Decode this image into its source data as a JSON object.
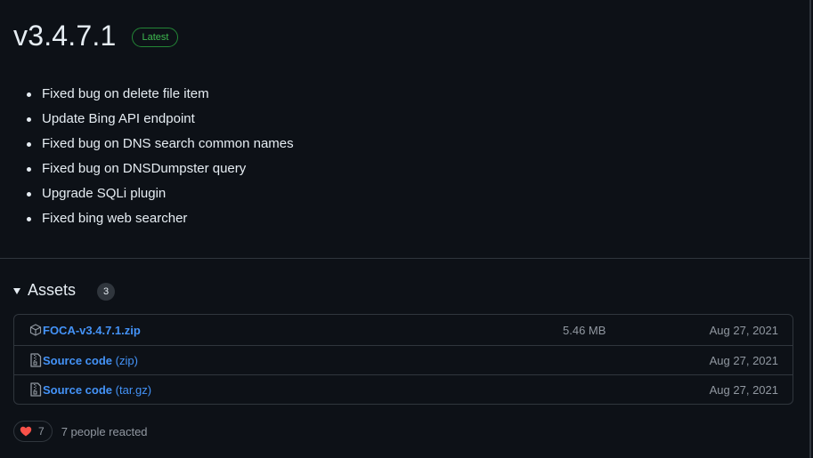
{
  "release": {
    "title": "v3.4.7.1",
    "badge": "Latest",
    "notes": [
      "Fixed bug on delete file item",
      "Update Bing API endpoint",
      "Fixed bug on DNS search common names",
      "Fixed bug on DNSDumpster query",
      "Upgrade SQLi plugin",
      "Fixed bing web searcher"
    ]
  },
  "assets": {
    "title": "Assets",
    "count": "3",
    "items": [
      {
        "icon": "package-icon",
        "name": "FOCA-v3.4.7.1.zip",
        "ext": "",
        "size": "5.46 MB",
        "date": "Aug 27, 2021"
      },
      {
        "icon": "file-zip-icon",
        "name": "Source code",
        "ext": " (zip)",
        "size": "",
        "date": "Aug 27, 2021"
      },
      {
        "icon": "file-zip-icon",
        "name": "Source code",
        "ext": " (tar.gz)",
        "size": "",
        "date": "Aug 27, 2021"
      }
    ]
  },
  "reactions": {
    "icon": "heart-icon",
    "count": "7",
    "summary": "7 people reacted"
  },
  "colors": {
    "background": "#0d1117",
    "border": "#30363d",
    "link": "#4493f8",
    "latest_green": "#3fb950",
    "heart_red": "#f85149",
    "muted": "#9198a1"
  }
}
